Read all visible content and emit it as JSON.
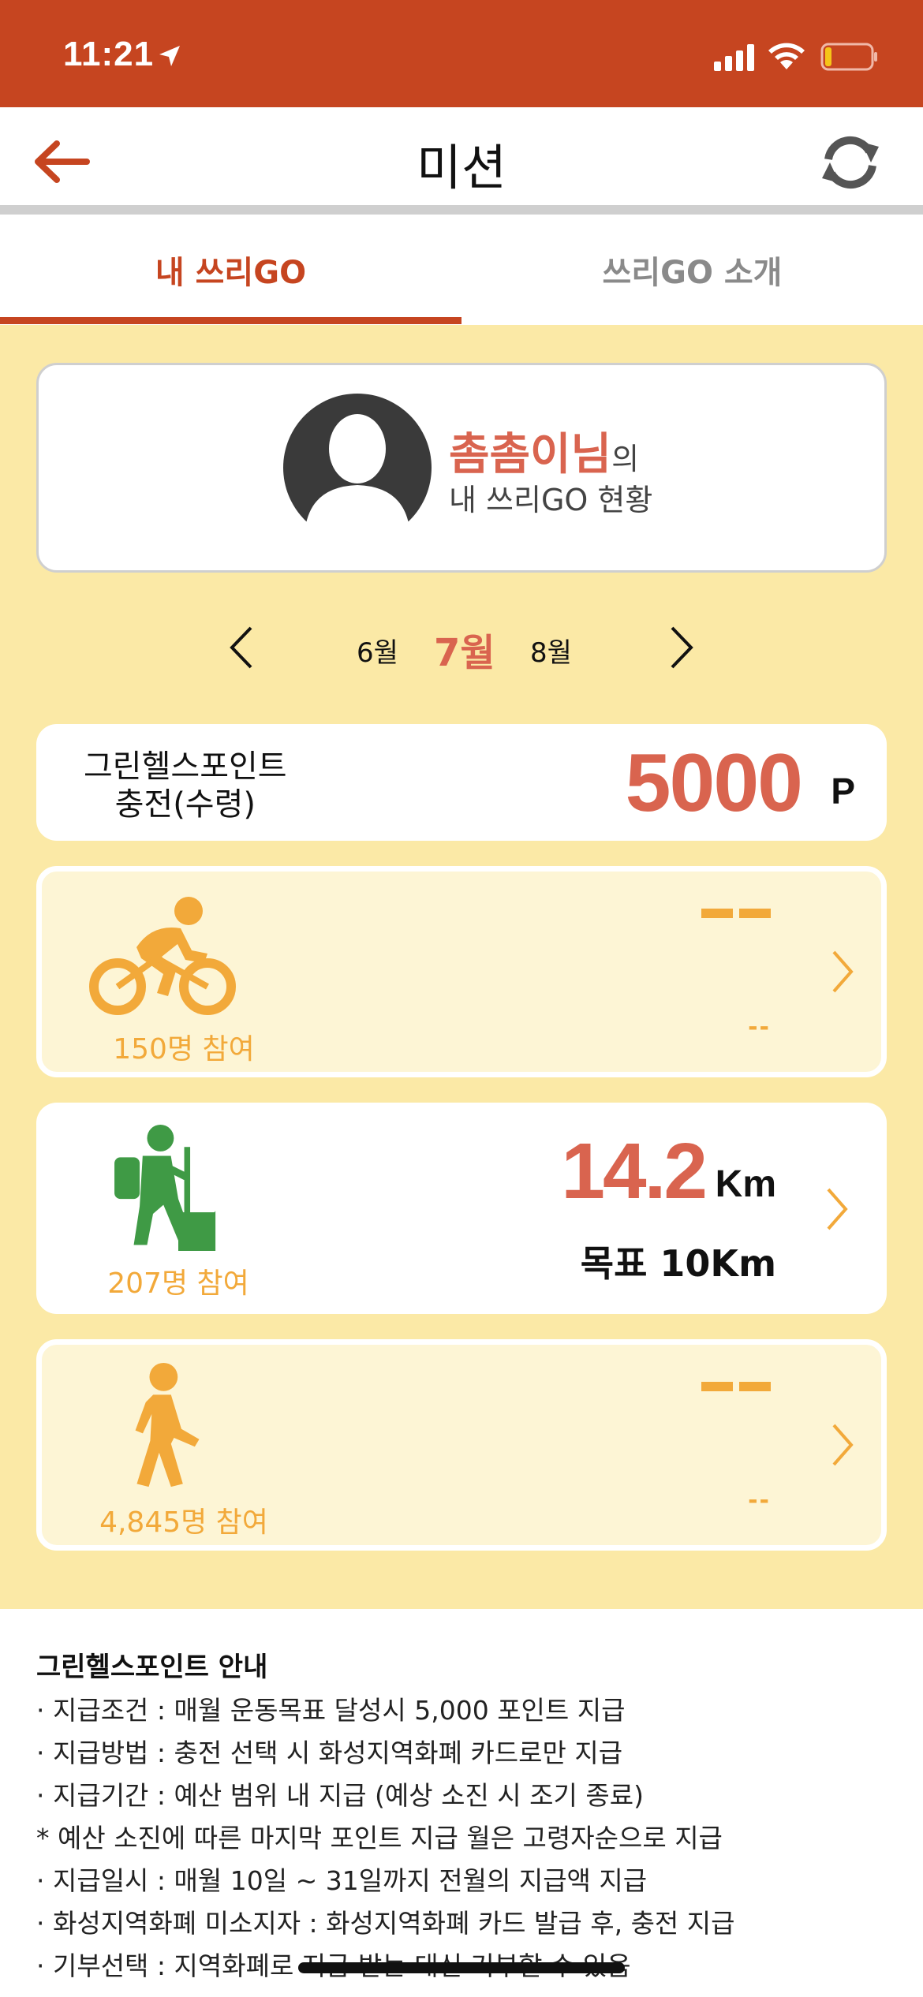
{
  "status_bar": {
    "time": "11:21"
  },
  "header": {
    "title": "미션"
  },
  "tabs": [
    {
      "label": "내 쓰리GO",
      "active": true
    },
    {
      "label": "쓰리GO 소개",
      "active": false
    }
  ],
  "profile": {
    "name": "촘촘이님",
    "suffix": "의",
    "subtitle": "내 쓰리GO 현황"
  },
  "months": {
    "prev": "6월",
    "current": "7월",
    "next": "8월"
  },
  "points": {
    "title_line1": "그린헬스포인트",
    "title_line2": "충전(수령)",
    "value": "5000",
    "unit": "P"
  },
  "activities": [
    {
      "icon": "bicycle-icon",
      "participants": "150명 참여",
      "value": "--",
      "sub_value": "--",
      "active": false
    },
    {
      "icon": "hiking-icon",
      "participants": "207명 참여",
      "value": "14.2",
      "unit": "Km",
      "goal": "목표 10Km",
      "active": true
    },
    {
      "icon": "walking-icon",
      "participants": "4,845명 참여",
      "value": "--",
      "sub_value": "--",
      "active": false
    }
  ],
  "info": {
    "title": "그린헬스포인트 안내",
    "items": [
      "· 지급조건 : 매월 운동목표 달성시 5,000 포인트 지급",
      "· 지급방법 : 충전 선택 시 화성지역화폐 카드로만 지급",
      "· 지급기간 : 예산 범위 내 지급 (예상 소진 시 조기 종료)",
      "   * 예산 소진에 따른 마지막 포인트 지급 월은 고령자순으로 지급",
      "· 지급일시 : 매월 10일 ~ 31일까지 전월의 지급액 지급",
      "· 화성지역화폐 미소지자 : 화성지역화폐 카드 발급 후, 충전 지급",
      "· 기부선택 : 지역화폐로 지급 받는 대신 기부할 수 있음"
    ]
  },
  "colors": {
    "brand": "#c64520",
    "accent_value": "#d9644f",
    "participants": "#f2a93a",
    "background": "#fbe9a6",
    "hiking_green": "#3f9a45"
  }
}
